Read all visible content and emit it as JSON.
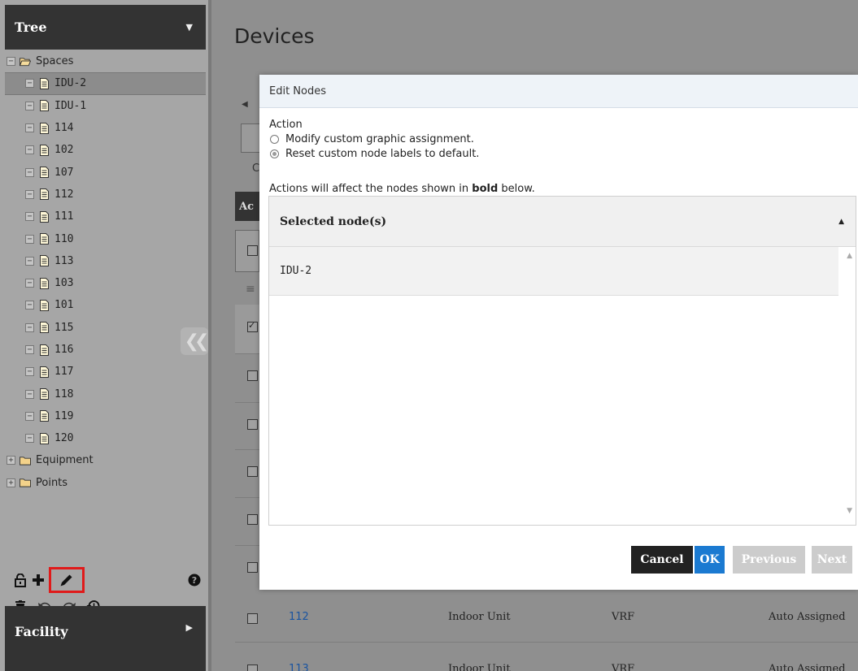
{
  "sidebar": {
    "tree_title": "Tree",
    "facility_title": "Facility",
    "root": {
      "label": "Spaces"
    },
    "spaces": [
      "IDU-2",
      "IDU-1",
      "114",
      "102",
      "107",
      "112",
      "111",
      "110",
      "113",
      "103",
      "101",
      "115",
      "116",
      "117",
      "118",
      "119",
      "120"
    ],
    "folders": [
      "Equipment",
      "Points"
    ]
  },
  "main": {
    "page_title": "Devices",
    "frag_c": "C",
    "frag_ac": "Ac",
    "rows": [
      {
        "name": "112",
        "type": "Indoor Unit",
        "category": "VRF",
        "assign": "Auto Assigned"
      },
      {
        "name": "113",
        "type": "Indoor Unit",
        "category": "VRF",
        "assign": "Auto Assigned"
      }
    ]
  },
  "dialog": {
    "title": "Edit Nodes",
    "action_label": "Action",
    "options": [
      "Modify custom graphic assignment.",
      "Reset custom node labels to default."
    ],
    "selected_option": 1,
    "affect_prefix": "Actions will affect the nodes shown in ",
    "affect_bold": "bold",
    "affect_suffix": " below.",
    "table_header": "Selected node(s)",
    "nodes": [
      "IDU-2"
    ],
    "buttons": {
      "cancel": "Cancel",
      "ok": "OK",
      "previous": "Previous",
      "next": "Next"
    }
  },
  "colors": {
    "ok": "#1b7ad1",
    "cancel": "#222222",
    "highlight_border": "#e01a1a",
    "link": "#1a54a0"
  }
}
